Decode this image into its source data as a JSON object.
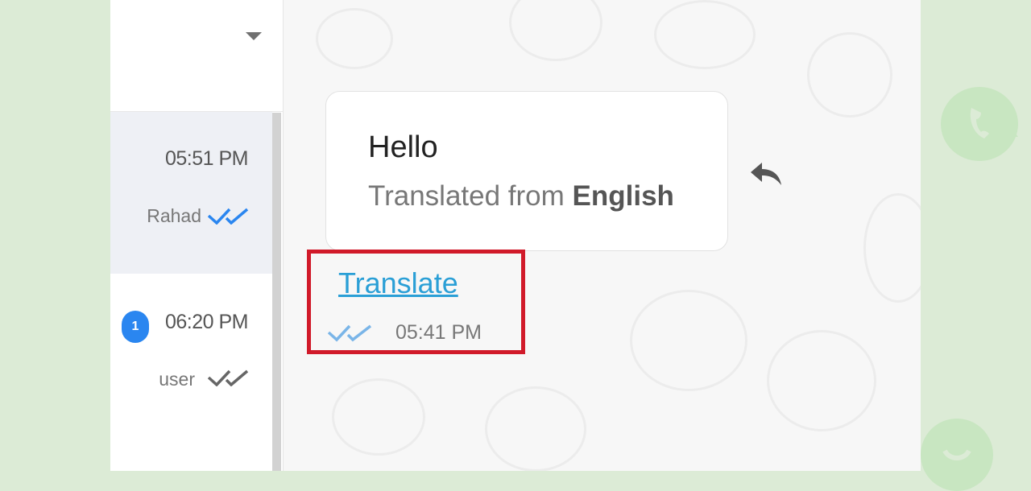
{
  "chats": [
    {
      "time": "05:51 PM",
      "sender": "Rahad",
      "read": true
    },
    {
      "time": "06:20 PM",
      "sender": "user",
      "unread_count": "1",
      "read": false
    }
  ],
  "message": {
    "text": "Hello",
    "translated_prefix": "Translated from ",
    "translated_language": "English",
    "translate_link": "Translate",
    "time": "05:41 PM"
  },
  "colors": {
    "accent_blue": "#2a9fd6",
    "check_blue": "#2a86f0",
    "highlight_red": "#d11a2a",
    "page_bg": "#dcebd6"
  },
  "icons": [
    "dropdown-caret-icon",
    "double-check-icon",
    "reply-icon",
    "phone-icon",
    "whatsapp-icon"
  ]
}
